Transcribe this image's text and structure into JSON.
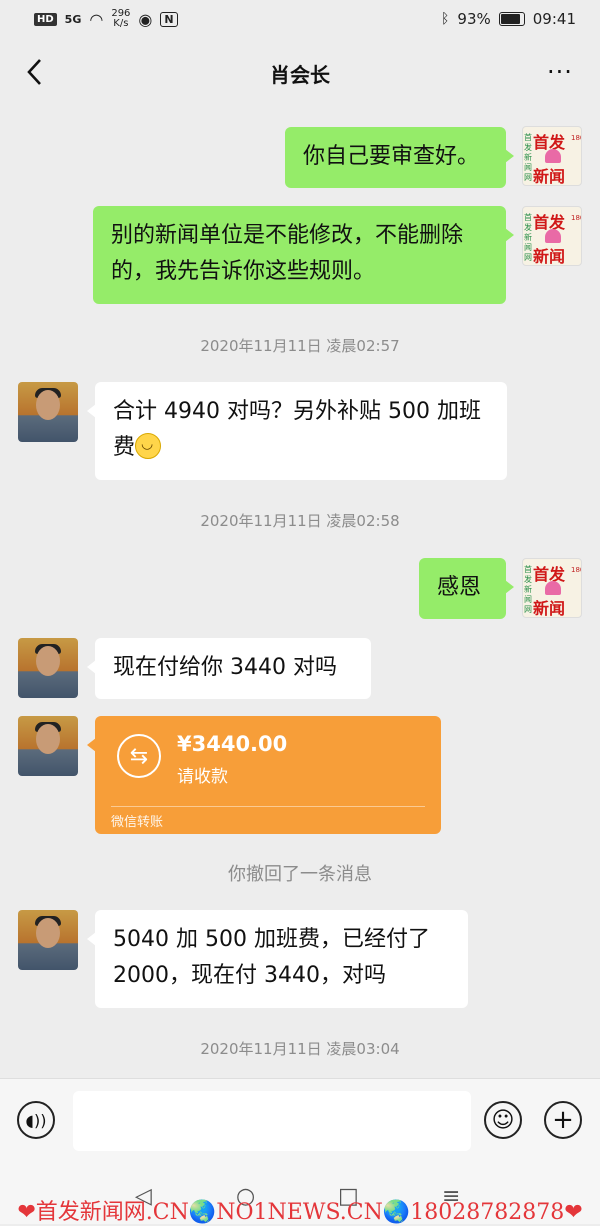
{
  "statusbar": {
    "hd": "HD",
    "signal": "5G",
    "net_speed_value": "296",
    "net_speed_unit": "K/s",
    "nfc": "N",
    "battery": "93%",
    "time": "09:41"
  },
  "header": {
    "title": "肖会长",
    "back_glyph": "<",
    "more_glyph": "···"
  },
  "messages": [
    {
      "side": "right",
      "text": "你自己要审查好。"
    },
    {
      "side": "right",
      "text": "别的新闻单位是不能修改，不能删除的，我先告诉你这些规则。"
    },
    {
      "timestamp": "2020年11月11日 凌晨02:57"
    },
    {
      "side": "left",
      "text": "合计 4940 对吗？另外补贴 500 加班费",
      "emoji": "smile-emoji"
    },
    {
      "timestamp": "2020年11月11日 凌晨02:58"
    },
    {
      "side": "right",
      "text": "感恩"
    },
    {
      "side": "left",
      "text": "现在付给你 3440 对吗"
    },
    {
      "side": "left",
      "transfer": {
        "amount": "¥3440.00",
        "status": "请收款",
        "footer": "微信转账"
      }
    },
    {
      "system": "你撤回了一条消息"
    },
    {
      "side": "left",
      "text": "5040 加 500 加班费，已经付了 2000，现在付 3440，对吗"
    },
    {
      "timestamp": "2020年11月11日 凌晨03:04"
    }
  ],
  "self_avatar": {
    "line1": "首发",
    "line2": "新闻",
    "side_left": "首发新闻网",
    "side_right": "180287828"
  },
  "colors": {
    "my_bubble": "#95ec69",
    "other_bubble": "#ffffff",
    "transfer": "#f79e39",
    "background": "#ededed"
  },
  "watermark": "❤首发新闻网.CN🌏NO1NEWS.CN🌏18028782878❤",
  "inputbar": {
    "voice_icon": "voice-icon",
    "emoji_icon": "emoji-icon",
    "plus_icon": "plus-icon"
  }
}
